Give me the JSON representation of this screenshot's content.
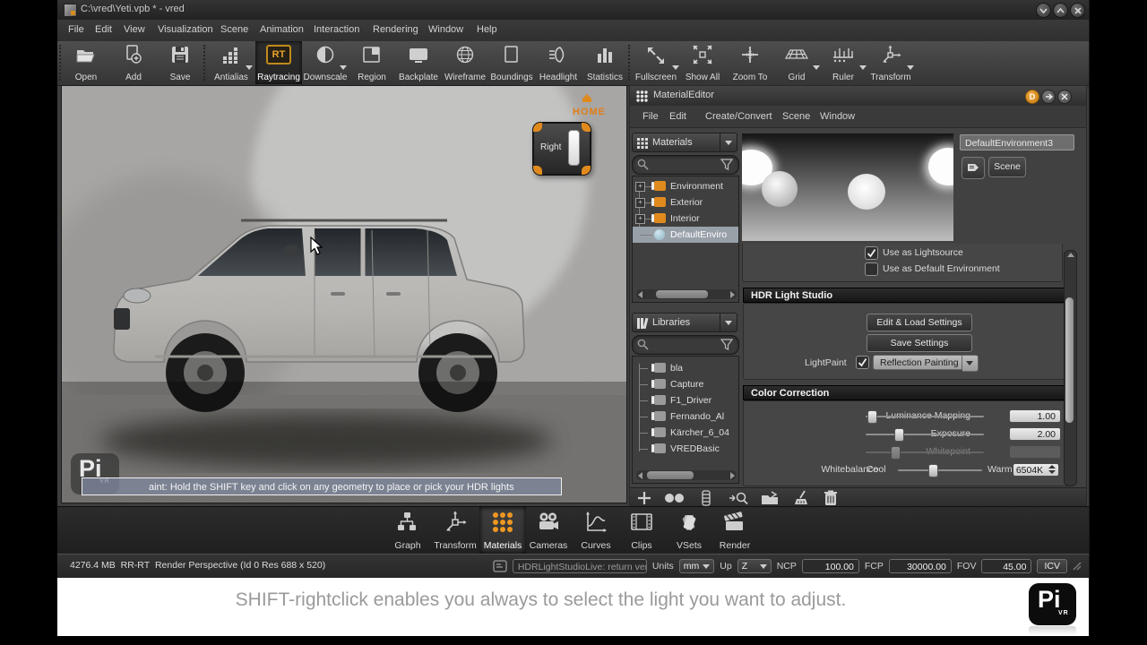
{
  "colors": {
    "accent": "#e08a1e",
    "selection": "#98a0a8",
    "viewport_bg": "#d8d6d3"
  },
  "window": {
    "title": "C:\\vred\\Yeti.vpb * - vred"
  },
  "menubar": [
    "File",
    "Edit",
    "View",
    "Visualization",
    "Scene",
    "Animation",
    "Interaction",
    "Rendering",
    "Window",
    "Help"
  ],
  "toolbar": {
    "items": [
      {
        "label": "Open"
      },
      {
        "label": "Add"
      },
      {
        "label": "Save"
      },
      {
        "label": "Antialias"
      },
      {
        "label": "Raytracing",
        "icon_text": "RT",
        "active": true
      },
      {
        "label": "Downscale"
      },
      {
        "label": "Region"
      },
      {
        "label": "Backplate"
      },
      {
        "label": "Wireframe"
      },
      {
        "label": "Boundings"
      },
      {
        "label": "Headlight"
      },
      {
        "label": "Statistics"
      },
      {
        "label": "Fullscreen"
      },
      {
        "label": "Show All"
      },
      {
        "label": "Zoom To"
      },
      {
        "label": "Grid"
      },
      {
        "label": "Ruler"
      },
      {
        "label": "Transform"
      }
    ]
  },
  "viewport": {
    "overlay_text": "aint: Hold the SHIFT key and click on any geometry to place or pick your HDR lights",
    "home_label": "HOME",
    "navcube_face": "Right",
    "watermark": "Pi",
    "watermark_sub": "VR"
  },
  "editor": {
    "title": "MaterialEditor",
    "header_buttons": {
      "d": "D"
    },
    "menus": [
      "File",
      "Edit",
      "Create/Convert",
      "Scene",
      "Window"
    ],
    "materials": {
      "combo_label": "Materials",
      "tree": [
        {
          "label": "Environment"
        },
        {
          "label": "Exterior"
        },
        {
          "label": "Interior"
        },
        {
          "label": "DefaultEnviro",
          "selected": true
        }
      ]
    },
    "libraries": {
      "combo_label": "Libraries",
      "tree": [
        {
          "label": "bla"
        },
        {
          "label": "Capture"
        },
        {
          "label": "F1_Driver"
        },
        {
          "label": "Fernando_Al"
        },
        {
          "label": "Kärcher_6_04"
        },
        {
          "label": "VREDBasic"
        }
      ]
    },
    "properties": {
      "name_value": "DefaultEnvironment3",
      "scene_button": "Scene",
      "use_lightsource": "Use as Lightsource",
      "use_default_env": "Use as Default Environment",
      "hdr": {
        "title": "HDR Light Studio",
        "edit_load": "Edit & Load Settings",
        "save": "Save Settings",
        "lightpaint": "LightPaint",
        "mode": "Reflection Painting"
      },
      "cc": {
        "title": "Color Correction",
        "rows": [
          {
            "label": "Luminance Mapping",
            "value": "1.00"
          },
          {
            "label": "Exposure",
            "value": "2.00"
          },
          {
            "label": "Whitepoint",
            "value": ""
          },
          {
            "label": "Whitebalance",
            "cool": "Cool",
            "warm": "Warm",
            "value": "6504K"
          }
        ]
      }
    }
  },
  "dock": {
    "items": [
      {
        "label": "Graph"
      },
      {
        "label": "Transform"
      },
      {
        "label": "Materials",
        "active": true
      },
      {
        "label": "Cameras"
      },
      {
        "label": "Curves"
      },
      {
        "label": "Clips"
      },
      {
        "label": "VSets"
      },
      {
        "label": "Render"
      }
    ]
  },
  "statusbar": {
    "memory": "4276.4 MB",
    "mode": "RR-RT",
    "render_info": "Render Perspective (Id 0 Res 688 x 520)",
    "hdr_status": "HDRLightStudioLive: return ver...",
    "units_label": "Units",
    "units_value": "mm",
    "up_label": "Up",
    "up_value": "Z",
    "ncp_label": "NCP",
    "ncp_value": "100.00",
    "fcp_label": "FCP",
    "fcp_value": "30000.00",
    "fov_label": "FOV",
    "fov_value": "45.00",
    "icv": "ICV"
  },
  "caption": {
    "text": "SHIFT-rightclick enables you always to select the light you want to adjust.",
    "logo": "Pi",
    "logo_sub": "VR"
  }
}
